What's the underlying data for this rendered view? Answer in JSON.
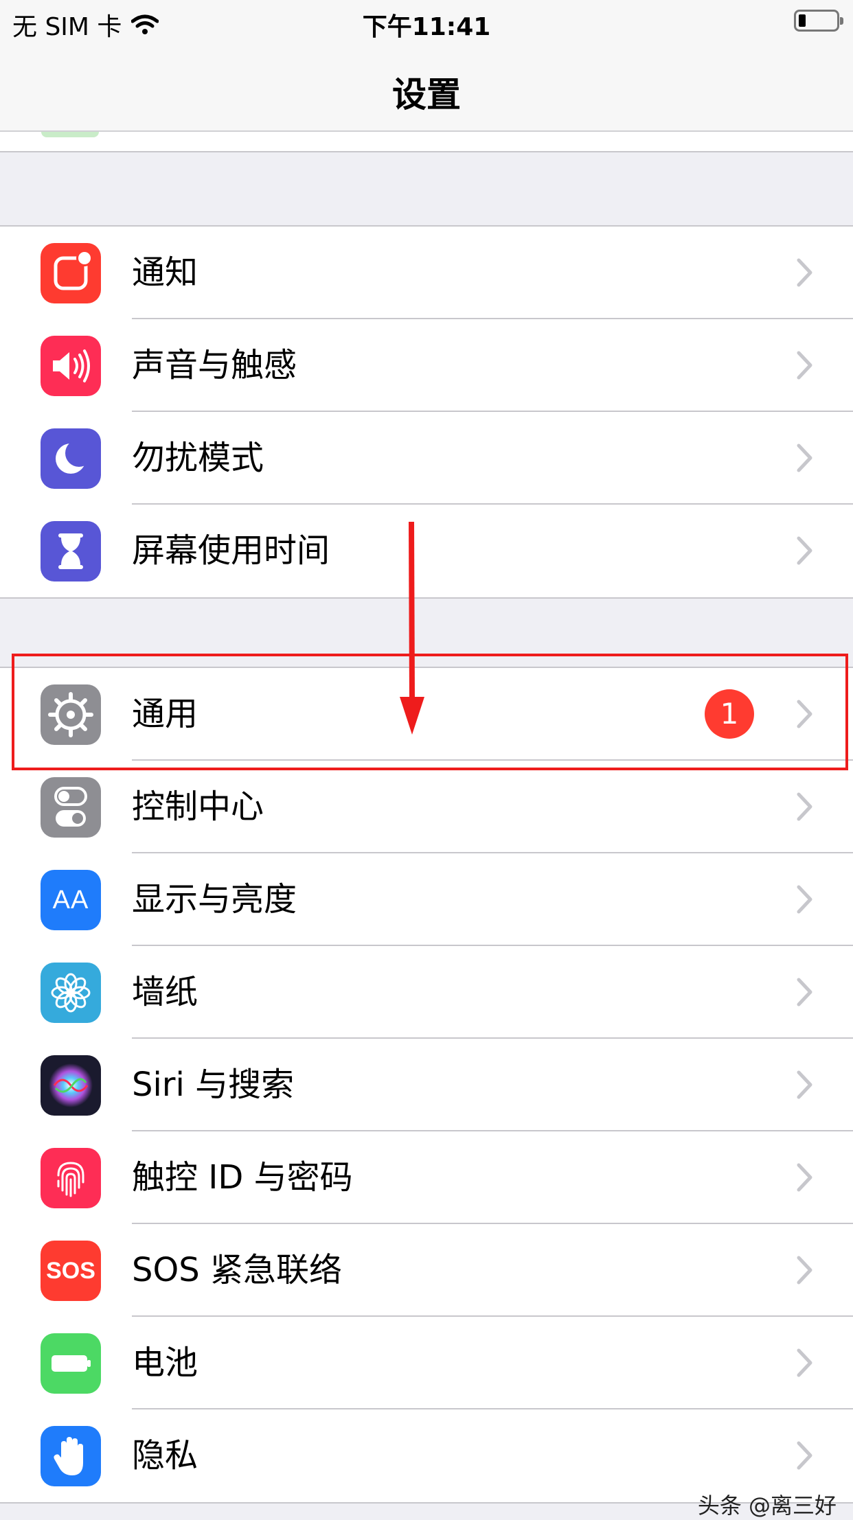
{
  "status_bar": {
    "carrier": "无 SIM 卡",
    "time": "下午11:41",
    "wifi_icon": "wifi-icon",
    "battery_level": 0.2
  },
  "nav": {
    "title": "设置"
  },
  "colors": {
    "notifications": "#fe3b30",
    "sounds": "#fe2d55",
    "dnd": "#5856d6",
    "screen_time": "#5856d6",
    "general": "#8e8e93",
    "control_center": "#8e8e93",
    "display": "#1f7cfb",
    "wallpaper": "#35aadc",
    "siri": "#1a1a2e",
    "touch_id": "#fe2d55",
    "sos": "#fe3b30",
    "battery": "#4cd964",
    "privacy": "#1f7cfb",
    "highlight": "#ee1c1c"
  },
  "group1": [
    {
      "label": "通知",
      "icon": "notifications-icon"
    },
    {
      "label": "声音与触感",
      "icon": "speaker-icon"
    },
    {
      "label": "勿扰模式",
      "icon": "moon-icon"
    },
    {
      "label": "屏幕使用时间",
      "icon": "hourglass-icon"
    }
  ],
  "group2": [
    {
      "label": "通用",
      "icon": "gear-icon",
      "badge": "1"
    },
    {
      "label": "控制中心",
      "icon": "toggles-icon"
    },
    {
      "label": "显示与亮度",
      "icon": "text-size-icon",
      "icon_text": "AA"
    },
    {
      "label": "墙纸",
      "icon": "flower-icon"
    },
    {
      "label": "Siri 与搜索",
      "icon": "siri-icon"
    },
    {
      "label": "触控 ID 与密码",
      "icon": "fingerprint-icon"
    },
    {
      "label": "SOS 紧急联络",
      "icon": "sos-icon",
      "icon_text": "SOS"
    },
    {
      "label": "电池",
      "icon": "battery-icon"
    },
    {
      "label": "隐私",
      "icon": "hand-icon"
    }
  ],
  "watermark": "头条 @离三好"
}
